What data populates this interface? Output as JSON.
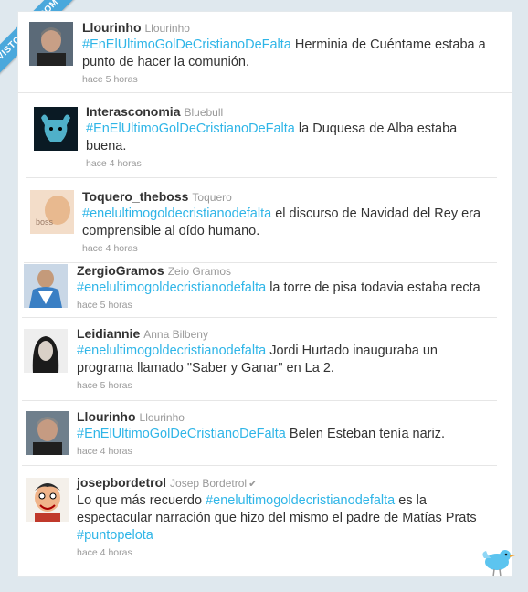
{
  "watermark": "VISTOENFB.COM",
  "tweets": [
    {
      "user": "Llourinho",
      "name": "Llourinho",
      "tag": "#EnElUltimoGolDeCristianoDeFalta",
      "text": " Herminia de Cuéntame estaba a punto de hacer la comunión.",
      "time": "hace 5 horas"
    },
    {
      "user": "Interasconomia",
      "name": "Bluebull",
      "tag": "#EnElUltimoGolDeCristianoDeFalta",
      "text": " la Duquesa de Alba estaba buena.",
      "time": "hace 4 horas"
    },
    {
      "user": "Toquero_theboss",
      "name": "Toquero",
      "tag": "#enelultimogoldecristianodefalta",
      "text": " el discurso de Navidad del Rey era comprensible al oído humano.",
      "time": "hace 4 horas"
    },
    {
      "user": "ZergioGramos",
      "name": "Zeio Gramos",
      "tag": "#enelultimogoldecristianodefalta",
      "text": " la torre de pisa todavia estaba recta",
      "time": "hace 5 horas"
    },
    {
      "user": "Leidiannie",
      "name": "Anna Bilbeny",
      "tag": "#enelultimogoldecristianodefalta",
      "text": " Jordi Hurtado inauguraba un programa llamado \"Saber y Ganar\" en La 2.",
      "time": "hace 5 horas"
    },
    {
      "user": "Llourinho",
      "name": "Llourinho",
      "tag": "#EnElUltimoGolDeCristianoDeFalta",
      "text": " Belen Esteban tenía nariz.",
      "time": "hace 4 horas"
    },
    {
      "user": "josepbordetrol",
      "name": "Josep Bordetrol",
      "pre": "Lo que más recuerdo ",
      "tag": "#enelultimogoldecristianodefalta",
      "text": " es la espectacular narración que hizo del mismo el padre de Matías Prats ",
      "tag2": "#puntopelota",
      "time": "hace 4 horas"
    }
  ],
  "avatar_caption": "boss",
  "colors": {
    "link": "#2fb5e7",
    "ribbon": "#4aa8dc",
    "background": "#dfe8ee"
  }
}
